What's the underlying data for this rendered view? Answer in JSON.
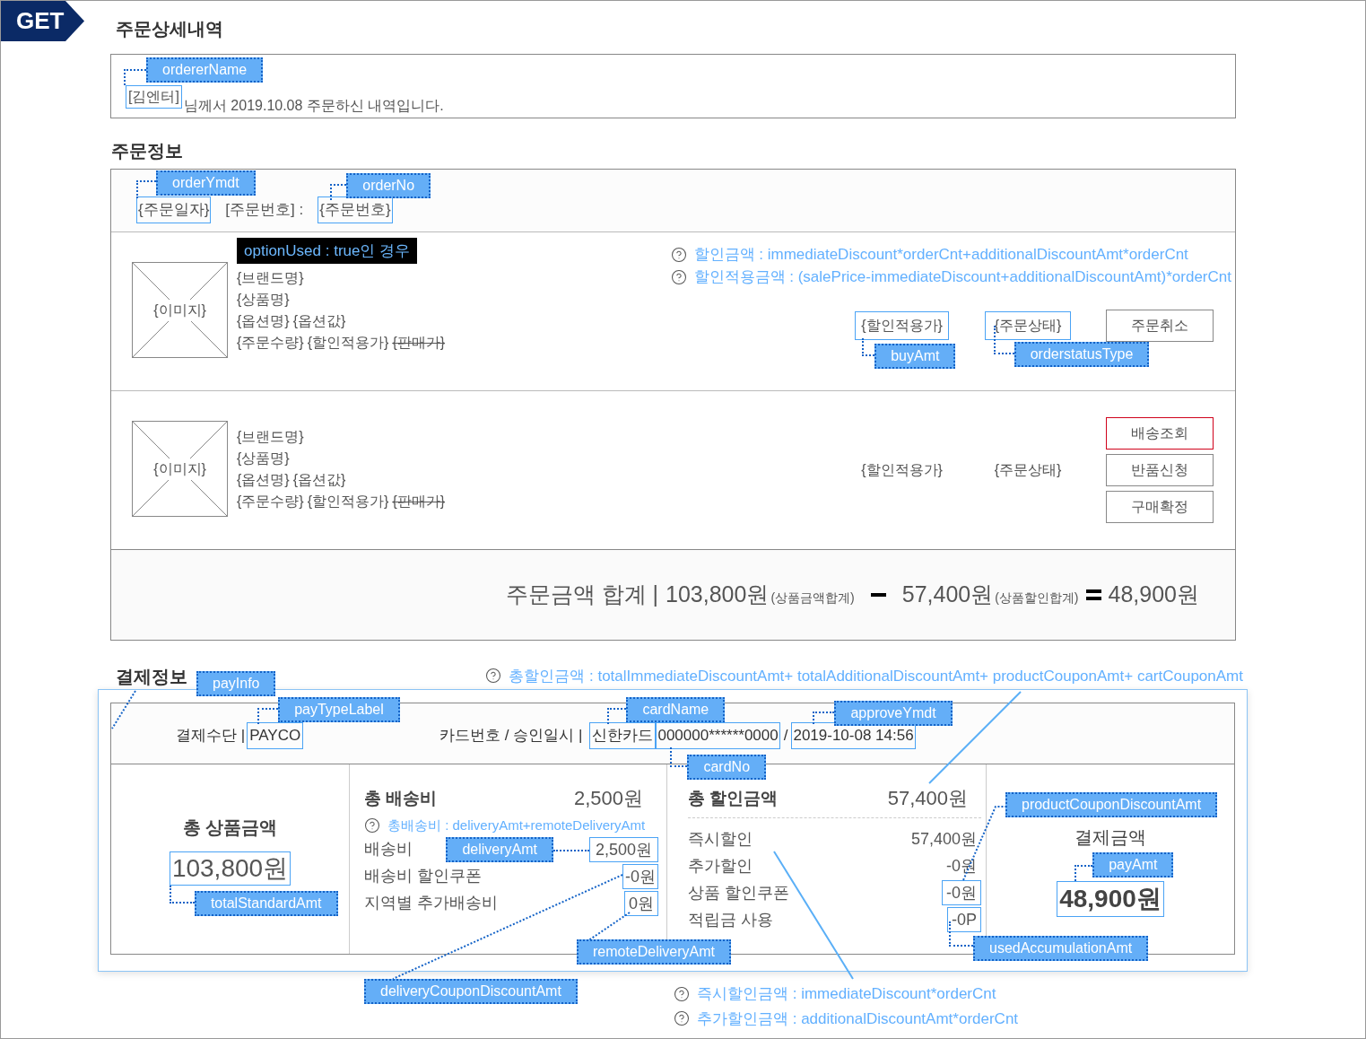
{
  "method": "GET",
  "order_detail": {
    "title": "주문상세내역",
    "orderer": {
      "value": "[김엔터]",
      "tag": "ordererName"
    },
    "message": "님께서 2019.10.08 주문하신 내역입니다."
  },
  "order_info": {
    "title": "주문정보",
    "order_date": {
      "value": "{주문일자}",
      "tag": "orderYmdt"
    },
    "order_no_label": "[주문번호] :",
    "order_no": {
      "value": "{주문번호}",
      "tag": "orderNo"
    },
    "products": [
      {
        "condition": "optionUsed : true인 경우",
        "notes": [
          "할인금액 : immediateDiscount*orderCnt+additionalDiscountAmt*orderCnt",
          "할인적용금액 : (salePrice-immediateDiscount+additionalDiscountAmt)*orderCnt"
        ],
        "image": "{이미지}",
        "brand": "{브랜드명}",
        "name": "{상품명}",
        "option_name": "{옵션명}",
        "option_value": "{옵션값}",
        "quantity": "{주문수량}",
        "sale_price": "{할인적용가}",
        "list_price": "{판매가}",
        "price": {
          "value": "{할인적용가}",
          "tag": "buyAmt"
        },
        "status": {
          "value": "{주문상태}",
          "tag": "orderstatusType"
        },
        "buttons": [
          {
            "label": "주문취소",
            "highlighted": false
          }
        ]
      },
      {
        "image": "{이미지}",
        "brand": "{브랜드명}",
        "name": "{상품명}",
        "option_name": "{옵션명}",
        "option_value": "{옵션값}",
        "quantity": "{주문수량}",
        "sale_price": "{할인적용가}",
        "list_price": "{판매가}",
        "price": {
          "value": "{할인적용가}"
        },
        "status": {
          "value": "{주문상태}"
        },
        "buttons": [
          {
            "label": "배송조회",
            "highlighted": true
          },
          {
            "label": "반품신청",
            "highlighted": false
          },
          {
            "label": "구매확정",
            "highlighted": false
          }
        ]
      }
    ],
    "summary": {
      "label": "주문금액 합계 |",
      "total": "103,800원",
      "total_note": "(상품금액합계)",
      "discount": "57,400원",
      "discount_note": "(상품할인합계)",
      "result": "48,900원"
    }
  },
  "payment": {
    "title": "결제정보",
    "tag": "payInfo",
    "note": "총할인금액 : totalImmediateDiscountAmt+ totalAdditionalDiscountAmt+ productCouponAmt+ cartCouponAmt",
    "pay_type_label": "결제수단 |",
    "pay_type": {
      "value": "PAYCO",
      "tag": "payTypeLabel"
    },
    "card_label": "카드번호 / 승인일시 |",
    "card_name": {
      "value": "신한카드",
      "tag": "cardName"
    },
    "card_no": {
      "value": "000000******0000",
      "tag": "cardNo"
    },
    "separator": "/",
    "approve": {
      "value": "2019-10-08 14:56",
      "tag": "approveYmdt"
    },
    "product_total": {
      "title": "총 상품금액",
      "value": "103,800원",
      "tag": "totalStandardAmt"
    },
    "delivery": {
      "title": "총 배송비",
      "value": "2,500원",
      "note": "총배송비 : deliveryAmt+remoteDeliveryAmt",
      "rows": [
        {
          "label": "배송비",
          "value": "2,500원",
          "tag": "deliveryAmt"
        },
        {
          "label": "배송비 할인쿠폰",
          "value": "-0원",
          "tag": "deliveryCouponDiscountAmt"
        },
        {
          "label": "지역별 추가배송비",
          "value": "0원",
          "tag": "remoteDeliveryAmt"
        }
      ]
    },
    "discount": {
      "title": "총 할인금액",
      "value": "57,400원",
      "rows": [
        {
          "label": "즉시할인",
          "value": "57,400원"
        },
        {
          "label": "추가할인",
          "value": "-0원"
        },
        {
          "label": "상품 할인쿠폰",
          "value": "-0원",
          "tag": "productCouponDiscountAmt"
        },
        {
          "label": "적립금 사용",
          "value": "-0P",
          "tag": "usedAccumulationAmt"
        }
      ]
    },
    "pay_amount": {
      "title": "결제금액",
      "value": "48,900원",
      "tag": "payAmt"
    }
  },
  "footer_notes": [
    "즉시할인금액 : immediateDiscount*orderCnt",
    "추가할인금액 : additionalDiscountAmt*orderCnt"
  ]
}
